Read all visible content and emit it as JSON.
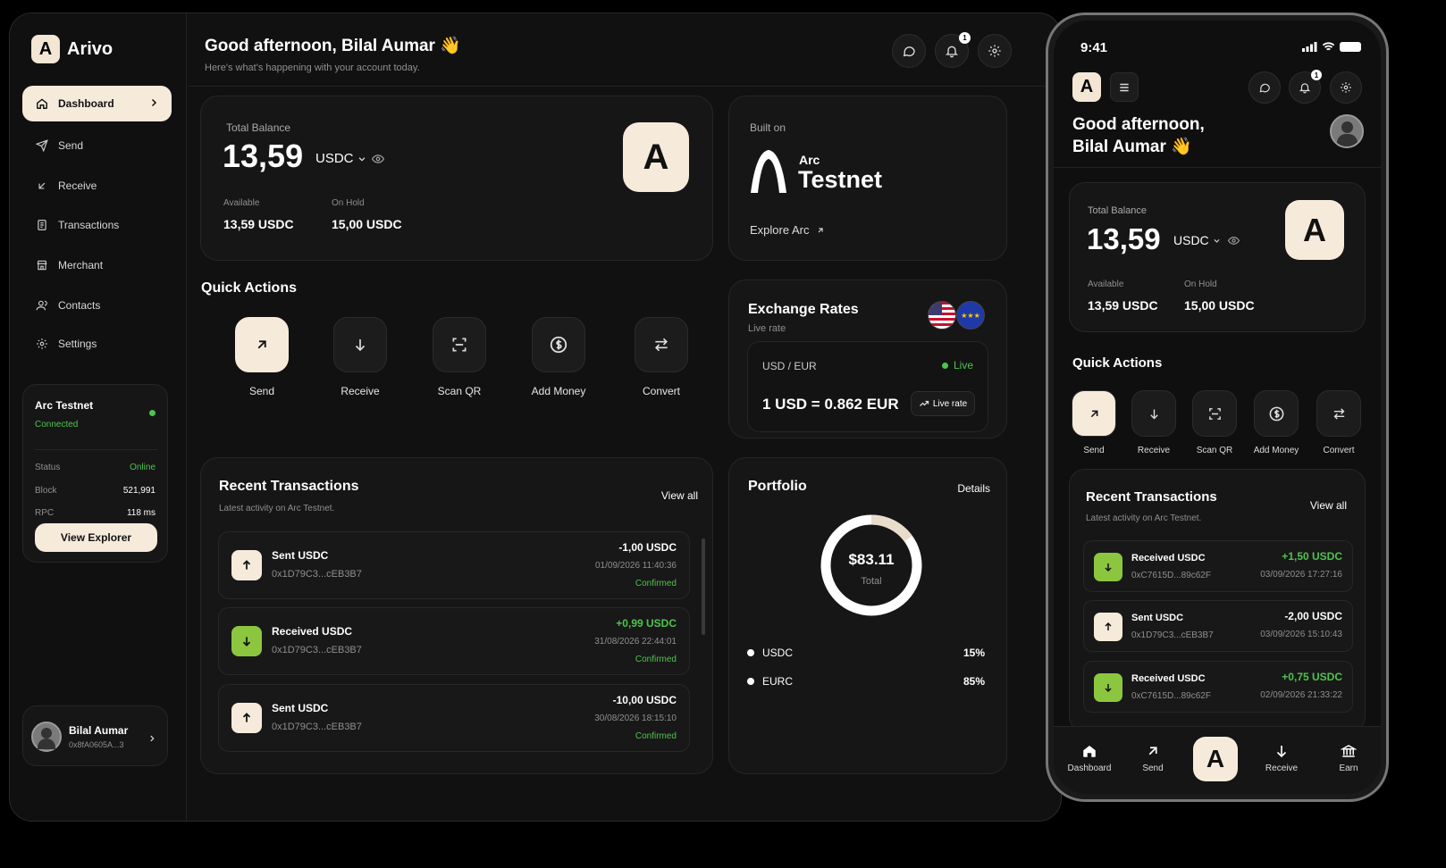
{
  "app": {
    "name": "Arivo",
    "logo_letter": "A"
  },
  "sidebar": {
    "items": [
      {
        "label": "Dashboard",
        "icon": "home-icon"
      },
      {
        "label": "Send",
        "icon": "send-icon"
      },
      {
        "label": "Receive",
        "icon": "receive-icon"
      },
      {
        "label": "Transactions",
        "icon": "receipt-icon"
      },
      {
        "label": "Merchant",
        "icon": "store-icon"
      },
      {
        "label": "Contacts",
        "icon": "contacts-icon"
      },
      {
        "label": "Settings",
        "icon": "gear-icon"
      }
    ],
    "network": {
      "title": "Arc Testnet",
      "state": "Connected",
      "status_label": "Status",
      "status_value": "Online",
      "block_label": "Block",
      "block_value": "521,991",
      "rpc_label": "RPC",
      "rpc_value": "118 ms",
      "button": "View Explorer"
    },
    "user": {
      "name": "Bilal Aumar",
      "address": "0x8fA0605A...3"
    }
  },
  "header": {
    "greeting": "Good afternoon, Bilal Aumar",
    "wave": "👋",
    "subtitle": "Here's what's happening with your account today.",
    "notification_count": "1"
  },
  "balance": {
    "label": "Total Balance",
    "amount": "13,59",
    "currency": "USDC",
    "available_label": "Available",
    "available_value": "13,59 USDC",
    "onhold_label": "On Hold",
    "onhold_value": "15,00 USDC"
  },
  "built_on": {
    "label": "Built on",
    "arc": "Arc",
    "network": "Testnet",
    "link": "Explore Arc"
  },
  "quick_actions": {
    "title": "Quick Actions",
    "items": [
      {
        "label": "Send",
        "icon": "arrow-up-right-icon"
      },
      {
        "label": "Receive",
        "icon": "arrow-down-icon"
      },
      {
        "label": "Scan QR",
        "icon": "scan-icon"
      },
      {
        "label": "Add Money",
        "icon": "dollar-icon"
      },
      {
        "label": "Convert",
        "icon": "swap-icon"
      }
    ]
  },
  "exchange": {
    "title": "Exchange Rates",
    "subtitle": "Live rate",
    "pair": "USD / EUR",
    "live": "Live",
    "rate": "1 USD = 0.862 EUR",
    "rate_button": "Live rate"
  },
  "transactions": {
    "title": "Recent Transactions",
    "subtitle": "Latest activity on Arc Testnet.",
    "view_all": "View all",
    "items": [
      {
        "title": "Sent USDC",
        "address": "0x1D79C3...cEB3B7",
        "amount": "-1,00 USDC",
        "date": "01/09/2026 11:40:36",
        "status": "Confirmed"
      },
      {
        "title": "Received USDC",
        "address": "0x1D79C3...cEB3B7",
        "amount": "+0,99 USDC",
        "date": "31/08/2026 22:44:01",
        "status": "Confirmed"
      },
      {
        "title": "Sent USDC",
        "address": "0x1D79C3...cEB3B7",
        "amount": "-10,00 USDC",
        "date": "30/08/2026 18:15:10",
        "status": "Confirmed"
      }
    ]
  },
  "portfolio": {
    "title": "Portfolio",
    "details": "Details",
    "total": "$83.11",
    "total_label": "Total",
    "items": [
      {
        "name": "USDC",
        "percent": "15%",
        "value": 15
      },
      {
        "name": "EURC",
        "percent": "85%",
        "value": 85
      }
    ]
  },
  "mobile": {
    "time": "9:41",
    "greeting_line1": "Good afternoon,",
    "greeting_line2": "Bilal Aumar",
    "notification_count": "1",
    "transactions": [
      {
        "title": "Received USDC",
        "address": "0xC7615D...89c62F",
        "amount": "+1,50 USDC",
        "date": "03/09/2026 17:27:16",
        "type": "recv"
      },
      {
        "title": "Sent USDC",
        "address": "0x1D79C3...cEB3B7",
        "amount": "-2,00 USDC",
        "date": "03/09/2026 15:10:43",
        "type": "sent"
      },
      {
        "title": "Received USDC",
        "address": "0xC7615D...89c62F",
        "amount": "+0,75 USDC",
        "date": "02/09/2026 21:33:22",
        "type": "recv"
      }
    ],
    "tabbar": [
      {
        "label": "Dashboard"
      },
      {
        "label": "Send"
      },
      {
        "label": "Receive"
      },
      {
        "label": "Earn"
      }
    ]
  },
  "colors": {
    "accent": "#f6eadb",
    "green": "#4fc34f",
    "received_icon": "#8cc63f",
    "background": "#111111"
  }
}
